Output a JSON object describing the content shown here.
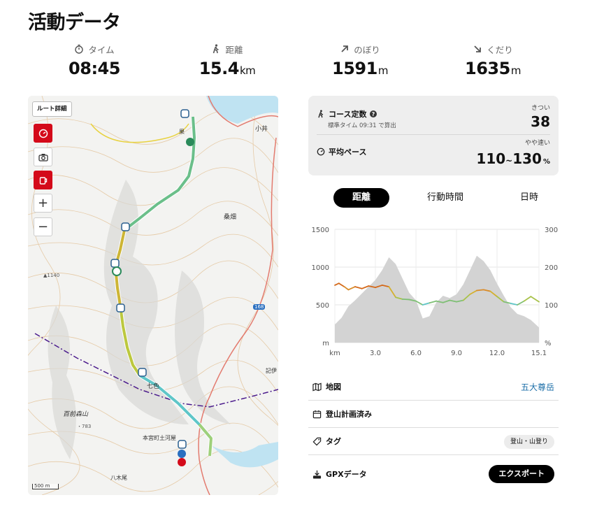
{
  "page": {
    "title": "活動データ"
  },
  "stats": [
    {
      "icon": "stopwatch-icon",
      "label": "タイム",
      "value": "08:45",
      "unit": ""
    },
    {
      "icon": "hiker-icon",
      "label": "距離",
      "value": "15.4",
      "unit": "km"
    },
    {
      "icon": "arrow-up-right-icon",
      "label": "のぼり",
      "value": "1591",
      "unit": "m"
    },
    {
      "icon": "arrow-down-right-icon",
      "label": "くだり",
      "value": "1635",
      "unit": "m"
    }
  ],
  "map": {
    "route_detail_label": "ルート詳細",
    "zoom_in": "+",
    "zoom_out": "−",
    "scale_label": "500 m",
    "labels": [
      "七色",
      "百前森山",
      "本宮町土河屋",
      "八木尾",
      "桑畑",
      "小井",
      "果",
      "▲1140",
      "168",
      "記伊",
      "・783"
    ]
  },
  "course": {
    "title": "コース定数",
    "subtitle": "標準タイム 09:31 で算出",
    "difficulty_label": "きつい",
    "value": "38",
    "pace_title": "平均ペース",
    "pace_tag": "やや速い",
    "pace_from": "110",
    "pace_sep": "~",
    "pace_to": "130",
    "pace_unit": "%"
  },
  "tabs": [
    {
      "label": "距離",
      "active": true
    },
    {
      "label": "行動時間",
      "active": false
    },
    {
      "label": "日時",
      "active": false
    }
  ],
  "chart_data": {
    "type": "area",
    "x_unit": "km",
    "y_left_unit": "m",
    "y_right_unit": "%",
    "ylim_left": [
      0,
      1500
    ],
    "ylim_right": [
      0,
      300
    ],
    "x_ticks": [
      "3.0",
      "6.0",
      "9.0",
      "12.0",
      "15.1"
    ],
    "y_left_ticks": [
      "1500",
      "1000",
      "500"
    ],
    "y_right_ticks": [
      "300",
      "200",
      "100"
    ],
    "grid": true,
    "series": [
      {
        "x": [
          0,
          0.5,
          1,
          1.5,
          2,
          2.5,
          3,
          3.5,
          4,
          4.5,
          5,
          5.5,
          6,
          6.5,
          7,
          7.5,
          8,
          8.5,
          9,
          9.5,
          10,
          10.5,
          11,
          11.5,
          12,
          12.5,
          13,
          13.5,
          14,
          14.5,
          15.1
        ],
        "values": [
          240,
          330,
          480,
          560,
          650,
          740,
          830,
          960,
          1130,
          1040,
          850,
          660,
          560,
          320,
          350,
          530,
          620,
          590,
          640,
          770,
          960,
          1150,
          1080,
          960,
          780,
          620,
          470,
          380,
          350,
          300,
          200
        ]
      },
      {
        "x": [
          0,
          0.3,
          0.7,
          1,
          1.5,
          2,
          2.5,
          3,
          3.5,
          4,
          4.5,
          5,
          5.5,
          6,
          6.5,
          7,
          7.5,
          8,
          8.5,
          9,
          9.5,
          10,
          10.5,
          11,
          11.5,
          12,
          12.5,
          13,
          13.5,
          14,
          14.5,
          15.1
        ],
        "values": [
          152,
          157,
          148,
          140,
          148,
          143,
          150,
          146,
          152,
          148,
          120,
          115,
          114,
          110,
          100,
          105,
          110,
          106,
          112,
          108,
          112,
          128,
          138,
          140,
          136,
          122,
          108,
          104,
          100,
          110,
          122,
          108
        ]
      }
    ]
  },
  "info_rows": [
    {
      "icon": "map-icon",
      "label": "地図",
      "value": "五大尊岳",
      "kind": "link"
    },
    {
      "icon": "calendar-icon",
      "label": "登山計画済み",
      "value": "",
      "kind": "none"
    },
    {
      "icon": "tag-icon",
      "label": "タグ",
      "value": "登山・山登り",
      "kind": "pill"
    },
    {
      "icon": "gpx-icon",
      "label": "GPXデータ",
      "value": "エクスポート",
      "kind": "button"
    }
  ],
  "colors": {
    "accent_red": "#d40a1a",
    "link": "#1d6fa8",
    "route_start": "#d4a017",
    "route_end": "#5fc6c8"
  }
}
